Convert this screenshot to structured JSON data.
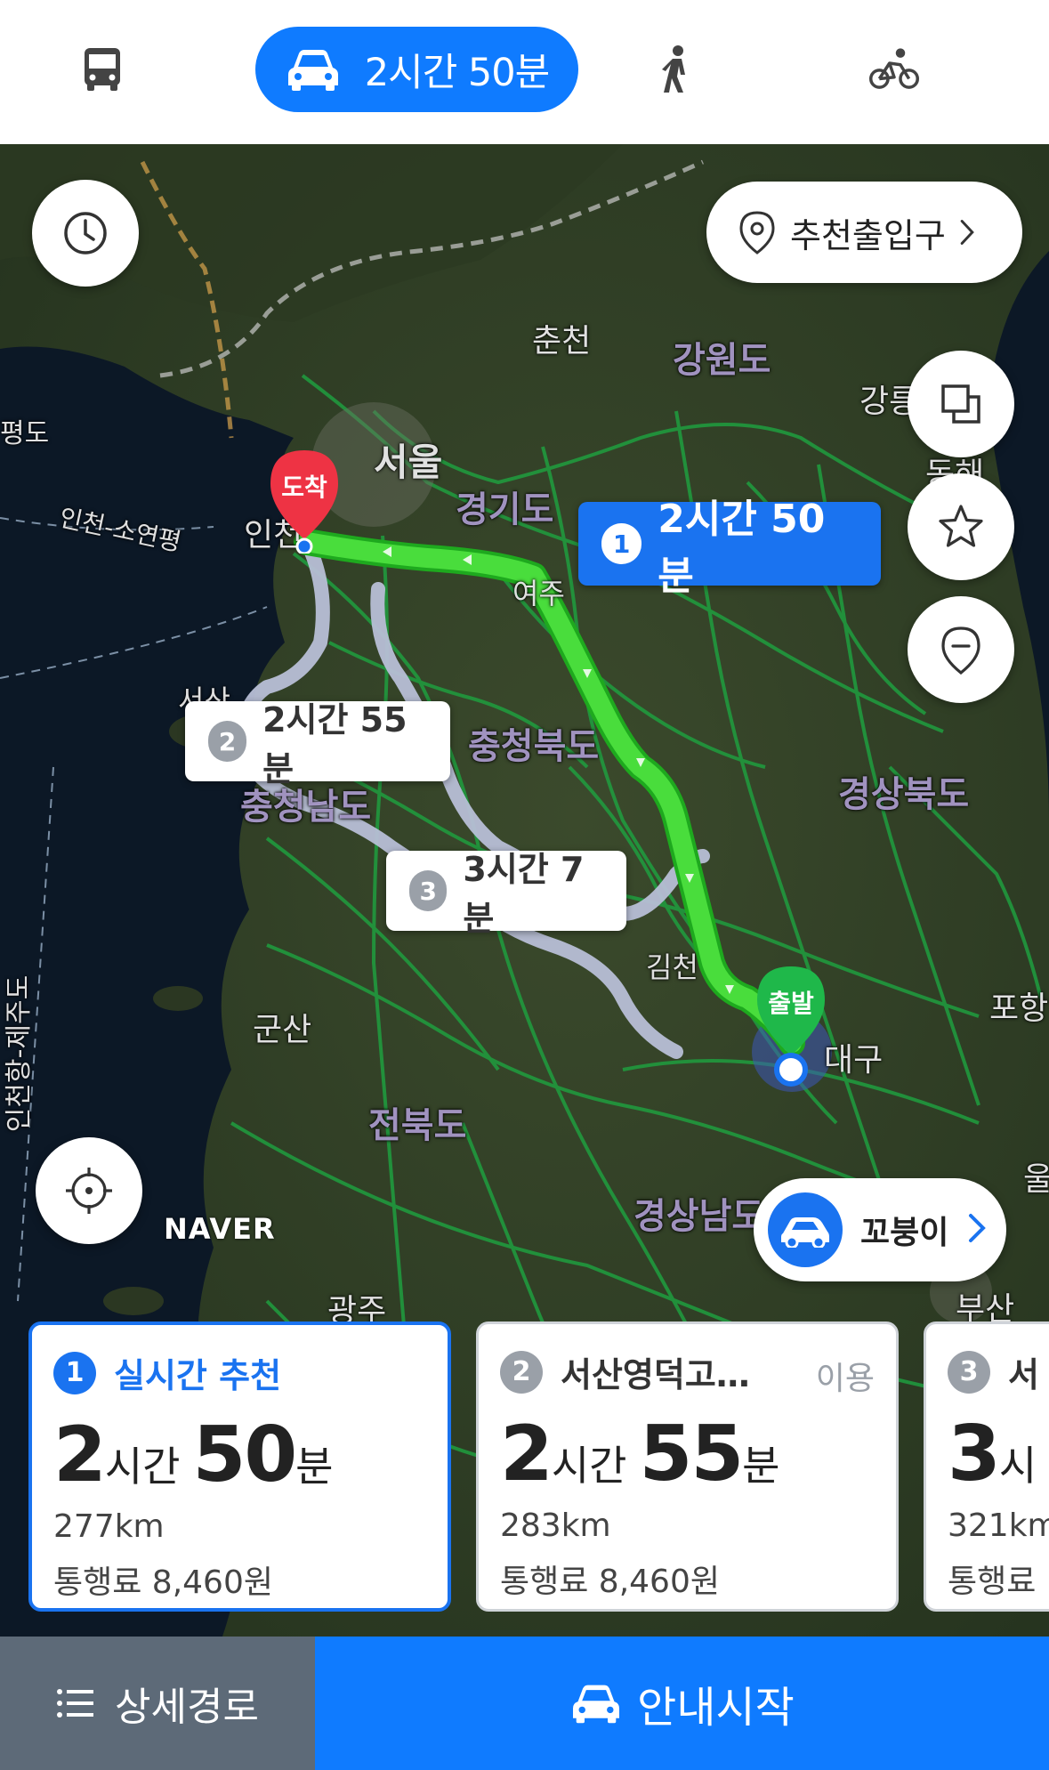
{
  "modes": {
    "bus_icon": "bus-icon",
    "car_icon": "car-icon",
    "car_label": "2시간 50분",
    "walk_icon": "walk-icon",
    "bike_icon": "bike-icon"
  },
  "map": {
    "entry_button_label": "추천출입구",
    "attribution": "NAVER",
    "places": {
      "chuncheon": "춘천",
      "gangwon": "강원도",
      "gangneung": "강릉",
      "donghae": "동해",
      "seoul": "서울",
      "gyeonggi": "경기도",
      "incheon": "인천",
      "incheon_yeonpyeong": "인천-소연평",
      "yeoju": "여주",
      "chungbuk": "충청북도",
      "chungnam": "충청남도",
      "seosan": "서산",
      "gyeongbuk": "경상북도",
      "gimcheon": "김천",
      "daegu": "대구",
      "pohang": "포항",
      "gunsan": "군산",
      "jeonbuk": "전북도",
      "gyeongnam": "경상남도",
      "ulsan": "울",
      "busan": "부산",
      "gwangju": "광주",
      "jeju_route": "인천항-제주도",
      "left_edge": "평도"
    },
    "pins": {
      "arrival": "도착",
      "departure": "출발"
    },
    "bubbles": [
      {
        "num": "1",
        "label": "2시간 50분"
      },
      {
        "num": "2",
        "label": "2시간 55분"
      },
      {
        "num": "3",
        "label": "3시간 7분"
      }
    ],
    "kkobugi_label": "꼬붕이"
  },
  "routes": [
    {
      "num": "1",
      "name": "실시간 추천",
      "use": "",
      "hours": "2",
      "hour_unit": "시간",
      "minutes": "50",
      "minute_unit": "분",
      "distance": "277km",
      "toll": "통행료 8,460원"
    },
    {
      "num": "2",
      "name": "서산영덕고…",
      "use": "이용",
      "hours": "2",
      "hour_unit": "시간",
      "minutes": "55",
      "minute_unit": "분",
      "distance": "283km",
      "toll": "통행료 8,460원"
    },
    {
      "num": "3",
      "name": "서",
      "use": "",
      "hours": "3",
      "hour_unit": "시",
      "minutes": "",
      "minute_unit": "",
      "distance": "321km",
      "toll": "통행료"
    }
  ],
  "bottom": {
    "detail_label": "상세경로",
    "start_label": "안내시작"
  },
  "colors": {
    "accent": "#0f7bff",
    "route_main": "#32c832",
    "route_alt": "#b8bfd6",
    "detail_bg": "#5d6a78"
  }
}
